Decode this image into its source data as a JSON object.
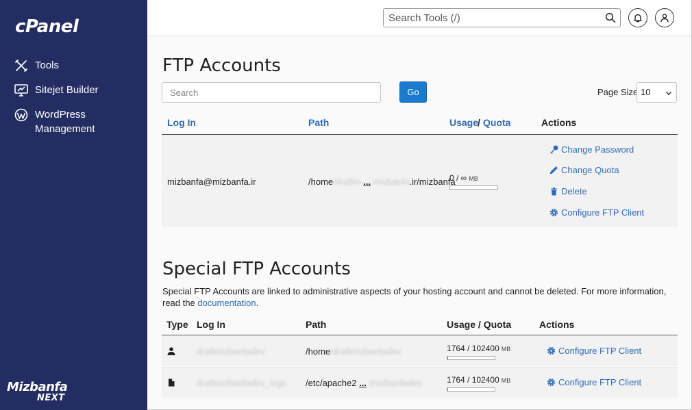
{
  "sidebar": {
    "logo": "cPanel",
    "items": [
      {
        "label": "Tools",
        "icon": "tools-icon"
      },
      {
        "label": "Sitejet Builder",
        "icon": "monitor-icon"
      },
      {
        "label": "WordPress Management",
        "icon": "wordpress-icon"
      }
    ],
    "brand_main": "Mizbanfa",
    "brand_sub": "NEXT"
  },
  "topbar": {
    "search_placeholder": "Search Tools (/)"
  },
  "ftp": {
    "title": "FTP Accounts",
    "search_placeholder": "Search",
    "go_label": "Go",
    "page_size_label": "Page Size",
    "page_size_value": "10",
    "columns": {
      "login": "Log In",
      "path": "Path",
      "usage": "Usage",
      "slash": "/",
      "quota": "Quota",
      "actions": "Actions"
    },
    "rows": [
      {
        "login": "mizbanfa@mizbanfa.ir",
        "path_start": "/home",
        "path_hidden": "/draftm",
        "path_ellipsis": "...",
        "path_end": ".ir/mizbanfa",
        "usage": "0 / ∞",
        "unit": "MB",
        "usage_fraction": 0,
        "actions": [
          "Change Password",
          "Change Quota",
          "Delete",
          "Configure FTP Client"
        ]
      }
    ]
  },
  "special": {
    "title": "Special FTP Accounts",
    "desc_text": "Special FTP Accounts are linked to administrative aspects of your hosting account and cannot be deleted. For more information, read the ",
    "desc_link": "documentation",
    "desc_end": ".",
    "columns": {
      "type": "Type",
      "login": "Log In",
      "path": "Path",
      "usage_quota": "Usage / Quota",
      "actions": "Actions"
    },
    "rows": [
      {
        "type_icon": "user-icon",
        "login_hidden": "draftmizbanfadev",
        "path_start": "/home",
        "path_hidden": "/draftmizbanfadev",
        "path_ellipsis": "",
        "usage": "1764 / 102400",
        "unit": "MB",
        "usage_fraction": 0.017,
        "action": "Configure FTP Client"
      },
      {
        "type_icon": "file-icon",
        "login_hidden": "draftmizbanfadev_logs",
        "path_start": "/etc/apache2",
        "path_hidden": "tmizbanfadev",
        "path_ellipsis": "...",
        "usage": "1764 / 102400",
        "unit": "MB",
        "usage_fraction": 0.017,
        "action": "Configure FTP Client"
      }
    ]
  },
  "colors": {
    "sidebar": "#232d61",
    "link": "#2f6db5",
    "button": "#1b7bce",
    "usage_bar": "#57b948"
  }
}
